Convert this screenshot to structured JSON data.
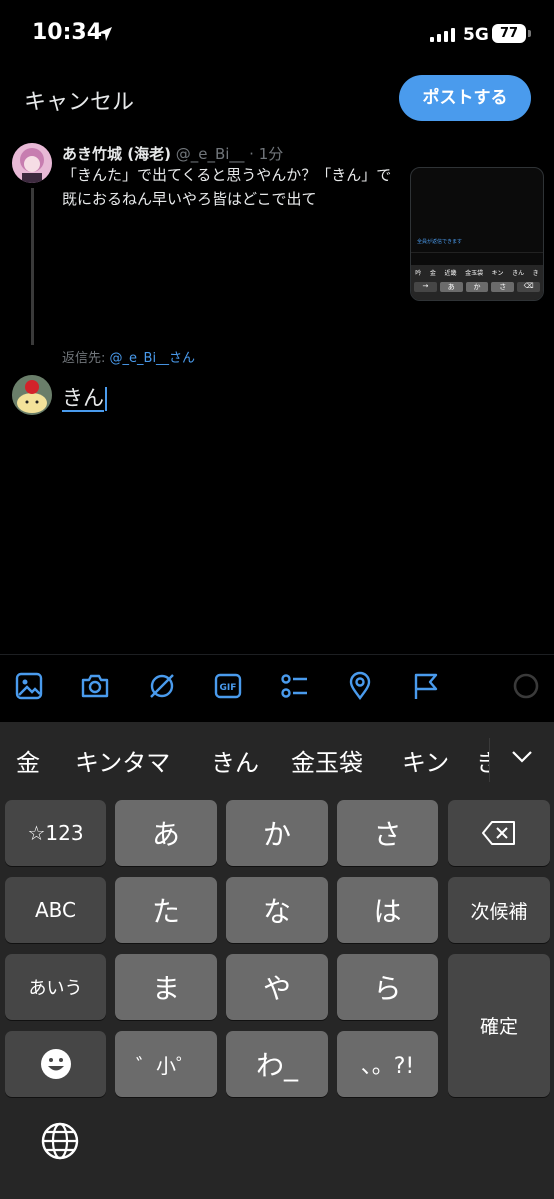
{
  "status_bar": {
    "time": "10:34",
    "network": "5G",
    "battery": "77"
  },
  "header": {
    "cancel_label": "キャンセル",
    "post_label": "ポストする"
  },
  "tweet": {
    "name": "あき竹城 (海老)",
    "meta": "@_e_Bi__ · 1分",
    "body": "「きんた」で出てくると思うやんか？「きん」で既におるねん早いやろ皆はどこで出て",
    "thumbnail": {
      "input_hint": "全員が返信できます",
      "candidates": [
        "吟",
        "金",
        "近畿",
        "金玉袋",
        "キン",
        "きん",
        "き"
      ],
      "keys": [
        "→",
        "あ",
        "か",
        "さ",
        "⌫"
      ]
    }
  },
  "reply": {
    "label": "返信先:",
    "handle": "@_e_Bi__さん"
  },
  "compose": {
    "text": "きん"
  },
  "toolbar": {
    "icons": [
      "image-icon",
      "camera-icon",
      "grok-icon",
      "gif-icon",
      "poll-icon",
      "location-icon",
      "flag-icon",
      "progress-ring-icon"
    ],
    "gif_label": "GIF"
  },
  "colors": {
    "accent": "#4a9bed",
    "background": "#000000",
    "keyboard": "#262626"
  },
  "keyboard": {
    "candidates": [
      "金",
      "キンタマ",
      "きん",
      "金玉袋",
      "キン",
      "き"
    ],
    "keys": {
      "sym": "☆123",
      "a": "あ",
      "ka": "か",
      "sa": "さ",
      "abc": "ABC",
      "ta": "た",
      "na": "な",
      "ha": "は",
      "next": "次候補",
      "aiu": "あいう",
      "ma": "ま",
      "ya": "や",
      "ra": "ら",
      "confirm": "確定",
      "dakuten": "゛小゜",
      "wa": "わ_",
      "punct": "、。?!"
    }
  }
}
